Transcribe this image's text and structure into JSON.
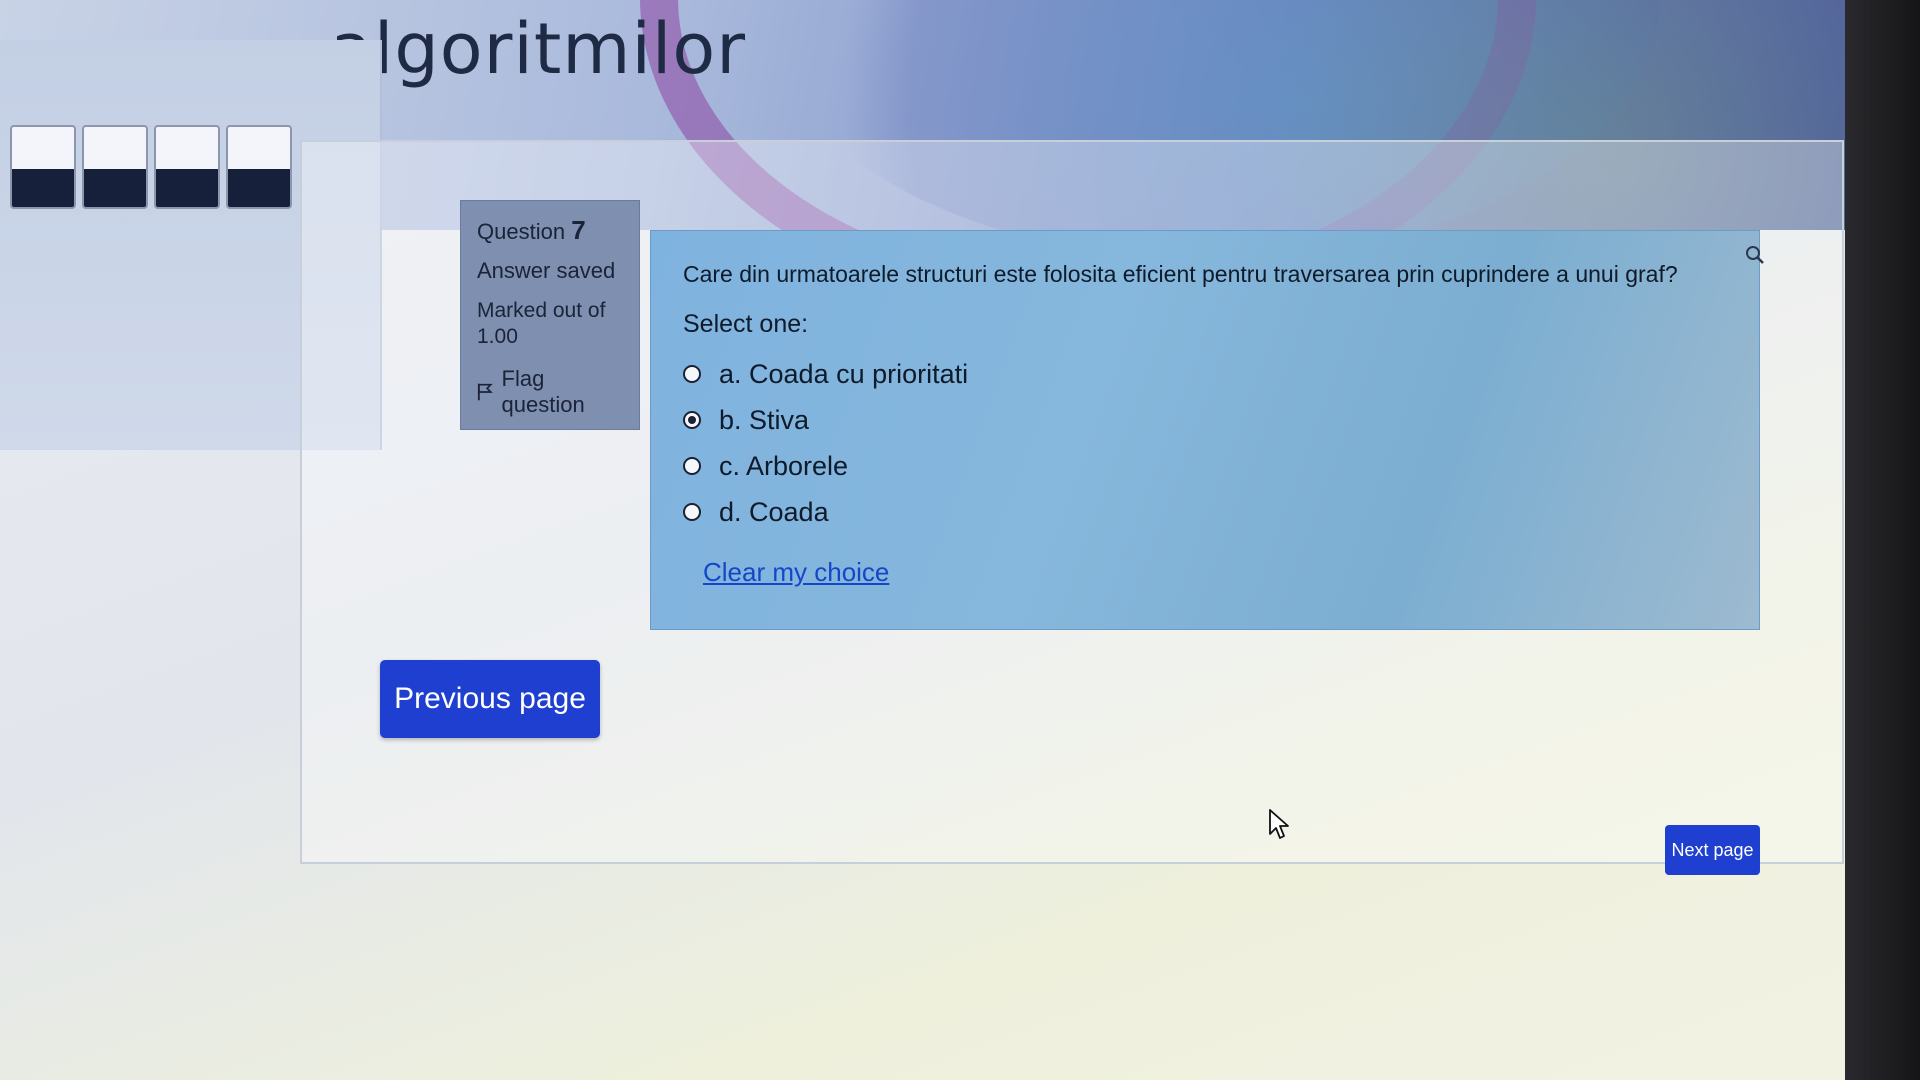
{
  "header": {
    "course_title": "algoritmilor"
  },
  "navigation": {
    "cells": [
      {
        "state": "answered"
      },
      {
        "state": "answered"
      },
      {
        "state": "answered"
      },
      {
        "state": "answered"
      }
    ]
  },
  "question_info": {
    "question_label": "Question",
    "question_number": "7",
    "status": "Answer saved",
    "marked_out_of_label": "Marked out of",
    "marked_out_of_value": "1.00",
    "flag_label": "Flag question"
  },
  "question": {
    "text": "Care din urmatoarele structuri este folosita eficient pentru traversarea prin cuprindere a unui graf?",
    "prompt": "Select one:",
    "answers": [
      {
        "label": "a. Coada cu prioritati",
        "selected": false
      },
      {
        "label": "b. Stiva",
        "selected": true
      },
      {
        "label": "c. Arborele",
        "selected": false
      },
      {
        "label": "d. Coada",
        "selected": false
      }
    ],
    "clear_label": "Clear my choice"
  },
  "buttons": {
    "previous_label": "Previous page",
    "next_label": "Next page"
  },
  "colors": {
    "button_blue": "#1f3fd0",
    "link_blue": "#1646c8",
    "question_bg": "#7fb3df",
    "info_bg": "#7e8fb0"
  }
}
